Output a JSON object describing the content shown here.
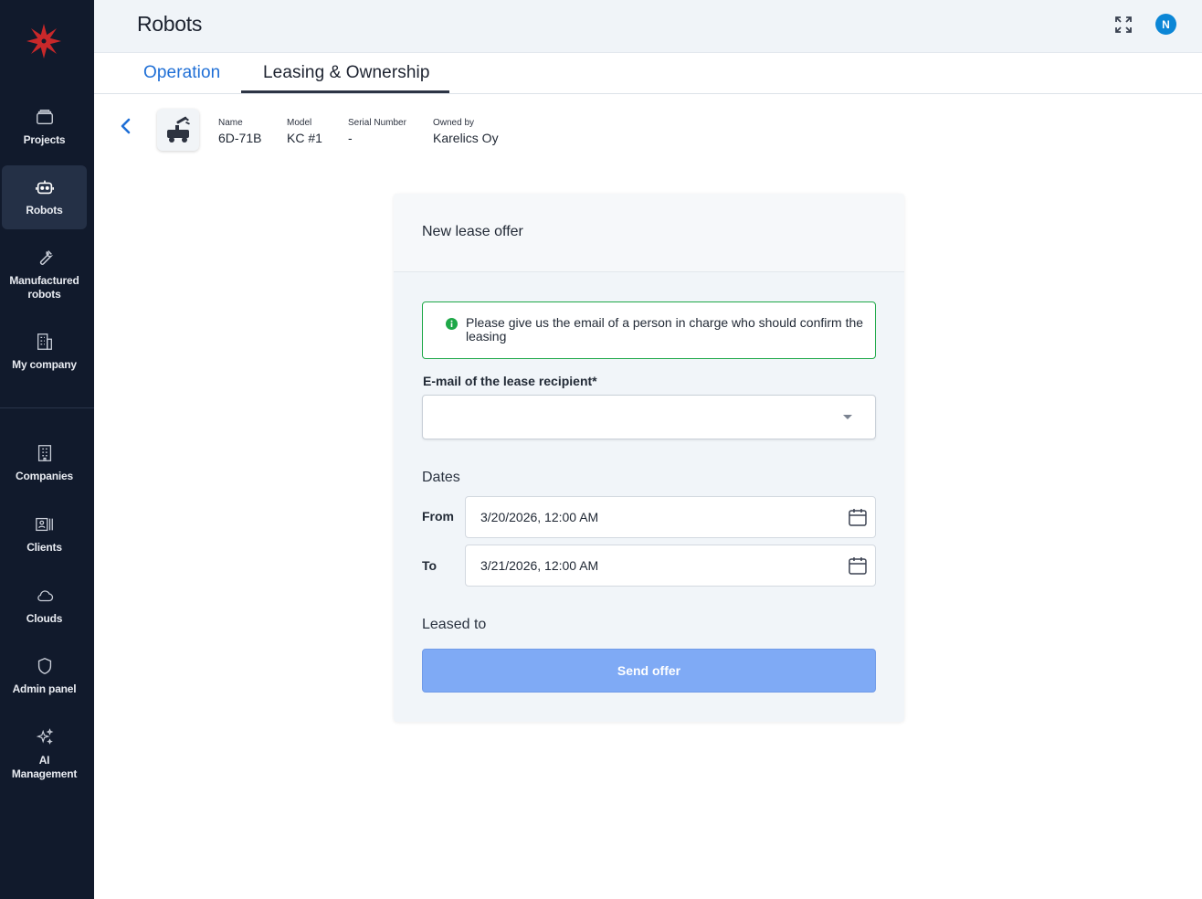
{
  "header": {
    "title": "Robots",
    "avatar_initial": "N"
  },
  "sidebar": {
    "items": [
      {
        "label": "Projects",
        "icon": "folder-icon"
      },
      {
        "label": "Robots",
        "icon": "robot-icon",
        "active": true
      },
      {
        "label": "Manufactured robots",
        "icon": "wrench-icon"
      },
      {
        "label": "My company",
        "icon": "building-icon"
      },
      {
        "label": "Companies",
        "icon": "office-icon"
      },
      {
        "label": "Clients",
        "icon": "contacts-icon"
      },
      {
        "label": "Clouds",
        "icon": "cloud-icon"
      },
      {
        "label": "Admin panel",
        "icon": "shield-icon"
      },
      {
        "label": "AI Management",
        "icon": "sparkle-icon"
      }
    ]
  },
  "tabs": [
    {
      "label": "Operation"
    },
    {
      "label": "Leasing & Ownership",
      "active": true
    }
  ],
  "robot": {
    "name_label": "Name",
    "name": "6D-71B",
    "model_label": "Model",
    "model": "KC #1",
    "serial_label": "Serial Number",
    "serial": "-",
    "owner_label": "Owned by",
    "owner": "Karelics Oy"
  },
  "form": {
    "title": "New lease offer",
    "info": "Please give us the email of a person in charge who should confirm the leasing",
    "email_label": "E-mail of the lease recipient*",
    "email_value": "",
    "dates_title": "Dates",
    "from_label": "From",
    "from_value": "3/20/2026, 12:00 AM",
    "to_label": "To",
    "to_value": "3/21/2026, 12:00 AM",
    "leased_to_title": "Leased to",
    "send_label": "Send offer"
  },
  "colors": {
    "sidebar_bg": "#111a2c",
    "accent": "#1f6fd6",
    "alert_border": "#1ea848",
    "send_button": "#7faaf5",
    "avatar": "#0b86d6"
  }
}
